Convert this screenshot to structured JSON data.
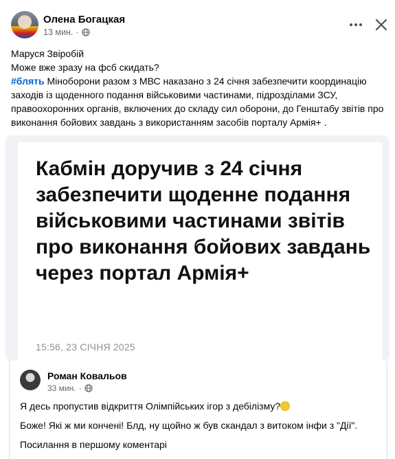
{
  "post": {
    "author": "Олена Богацкая",
    "time": "13 мин.",
    "line1": "Маруся Звіробій",
    "line2": "Може вже зразу на фсб скидать?",
    "hashtag": "#блять",
    "body": " Міноборони разом з МВС наказано з 24 січня забезпечити координацію заходів із щоденного подання військовими частинами, підрозділами ЗСУ, правоохоронних органів, включених до складу сил оборони, до Генштабу звітів про виконання бойових завдань з використанням засобів порталу Армія+ ."
  },
  "news_card": {
    "headline": "Кабмін доручив з 24 січня забезпечити щоденне подання військовими частинами звітів про виконання бойових завдань через портал Армія+",
    "date": "15:56, 23 СІЧНЯ 2025"
  },
  "embedded_post": {
    "author": "Роман Ковальов",
    "time": "33 мин.",
    "para1": "Я десь пропустив відкриття Олімпійських ігор з дебілізму?",
    "para2": "Боже! Які ж ми кончені! Блд, ну щойно ж був скандал з витоком інфи з \"Дії\".",
    "para3": "Посилання в першому коментарі"
  },
  "icons": {
    "more": "more-options-icon",
    "close": "close-icon",
    "audience": "globe-icon",
    "emoji": "laughing-emoji-icon"
  },
  "colors": {
    "hashtag": "#0064d1",
    "meta_text": "#65676b",
    "card_background": "#f0f2f5"
  }
}
